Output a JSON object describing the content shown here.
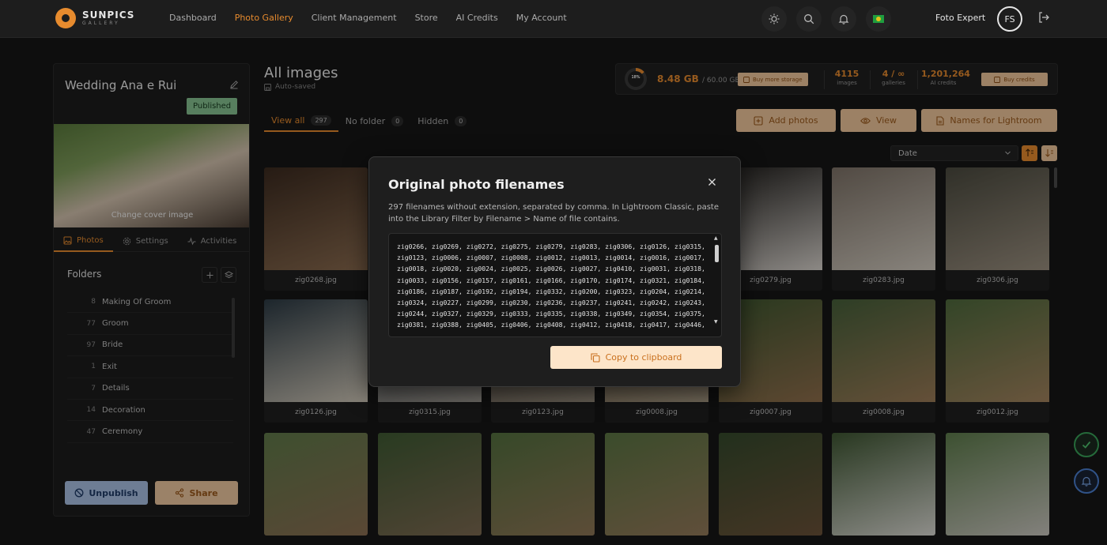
{
  "brand": {
    "name": "SUNPICS",
    "sub": "GALLERY"
  },
  "nav": {
    "items": [
      "Dashboard",
      "Photo Gallery",
      "Client Management",
      "Store",
      "AI Credits",
      "My Account"
    ],
    "user_name": "Foto Expert",
    "avatar_initials": "FS"
  },
  "sidebar": {
    "gallery_title": "Wedding Ana e Rui",
    "status": "Published",
    "change_cover": "Change cover image",
    "tabs": [
      "Photos",
      "Settings",
      "Activities"
    ],
    "folders_heading": "Folders",
    "folders": [
      {
        "count": "8",
        "name": "Making Of Groom"
      },
      {
        "count": "77",
        "name": "Groom"
      },
      {
        "count": "97",
        "name": "Bride"
      },
      {
        "count": "1",
        "name": "Exit"
      },
      {
        "count": "7",
        "name": "Details"
      },
      {
        "count": "14",
        "name": "Decoration"
      },
      {
        "count": "47",
        "name": "Ceremony"
      }
    ],
    "unpublish_label": "Unpublish",
    "share_label": "Share"
  },
  "main": {
    "title": "All images",
    "autosaved": "Auto-saved",
    "tabs": [
      {
        "label": "View all",
        "count": "297"
      },
      {
        "label": "No folder",
        "count": "0"
      },
      {
        "label": "Hidden",
        "count": "0"
      }
    ],
    "stats": {
      "storage_percent": "18%",
      "storage_used": "8.48 GB",
      "storage_total": "/ 60.00 GB",
      "buy_storage": "Buy more storage",
      "images_value": "4115",
      "images_label": "images",
      "galleries_value": "4 / ∞",
      "galleries_label": "galleries",
      "credits_value": "1,201,264",
      "credits_label": "AI credits",
      "buy_credits": "Buy credits"
    },
    "actions": {
      "add_photos": "Add photos",
      "view": "View",
      "names_lightroom": "Names for Lightroom"
    },
    "sort_select": "Date",
    "photos": [
      {
        "name": "zig0268.jpg",
        "c1": "#3b2a1f",
        "c2": "#8a6b4f"
      },
      {
        "name": "",
        "c1": "#30271f",
        "c2": "#6b5848"
      },
      {
        "name": "",
        "c1": "#2a2622",
        "c2": "#5d564f"
      },
      {
        "name": "",
        "c1": "#2d2a26",
        "c2": "#6e675f"
      },
      {
        "name": "zig0279.jpg",
        "c1": "#1f1d1b",
        "c2": "#d7d2cc"
      },
      {
        "name": "zig0283.jpg",
        "c1": "#7d7267",
        "c2": "#d1cabf"
      },
      {
        "name": "zig0306.jpg",
        "c1": "#4b4a3f",
        "c2": "#9a8f7f"
      },
      {
        "name": "zig0126.jpg",
        "c1": "#2c3a44",
        "c2": "#cfc7b8"
      },
      {
        "name": "zig0315.jpg",
        "c1": "#3a4148",
        "c2": "#a9a49c"
      },
      {
        "name": "zig0123.jpg",
        "c1": "#3e3831",
        "c2": "#9e9383"
      },
      {
        "name": "zig0008.jpg",
        "c1": "#5a4a36",
        "c2": "#b3a58d"
      },
      {
        "name": "zig0007.jpg",
        "c1": "#3f5730",
        "c2": "#8f6e4c"
      },
      {
        "name": "zig0008.jpg",
        "c1": "#47603a",
        "c2": "#9b7b57"
      },
      {
        "name": "zig0012.jpg",
        "c1": "#4f6a3d",
        "c2": "#a2835e"
      },
      {
        "name": "",
        "c1": "#607a4a",
        "c2": "#8a6e52"
      },
      {
        "name": "",
        "c1": "#3f5a33",
        "c2": "#7d6a52"
      },
      {
        "name": "",
        "c1": "#54703f",
        "c2": "#8e7656"
      },
      {
        "name": "",
        "c1": "#5b7543",
        "c2": "#947a5a"
      },
      {
        "name": "",
        "c1": "#354a2c",
        "c2": "#6b5239"
      },
      {
        "name": "",
        "c1": "#3e5632",
        "c2": "#d9d8d2"
      },
      {
        "name": "",
        "c1": "#5e7c4c",
        "c2": "#c9c6bf"
      }
    ]
  },
  "modal": {
    "title": "Original photo filenames",
    "description": "297 filenames without extension, separated by comma. In Lightroom Classic, paste into the Library Filter by Filename > Name of file contains.",
    "filenames": "zig0266, zig0269, zig0272, zig0275, zig0279, zig0283, zig0306, zig0126, zig0315, zig0123, zig0006, zig0007, zig0008, zig0012, zig0013, zig0014, zig0016, zig0017, zig0018, zig0020, zig0024, zig0025, zig0026, zig0027, zig0410, zig0031, zig0318, zig0033, zig0156, zig0157, zig0161, zig0166, zig0170, zig0174, zig0321, zig0184, zig0186, zig0187, zig0192, zig0194, zig0332, zig0200, zig0323, zig0204, zig0214, zig0324, zig0227, zig0299, zig0230, zig0236, zig0237, zig0241, zig0242, zig0243, zig0244, zig0327, zig0329, zig0333, zig0335, zig0338, zig0349, zig0354, zig0375, zig0381, zig0388, zig0405, zig0406, zig0408, zig0412, zig0418, zig0417, zig0446,",
    "copy_label": "Copy to clipboard"
  }
}
